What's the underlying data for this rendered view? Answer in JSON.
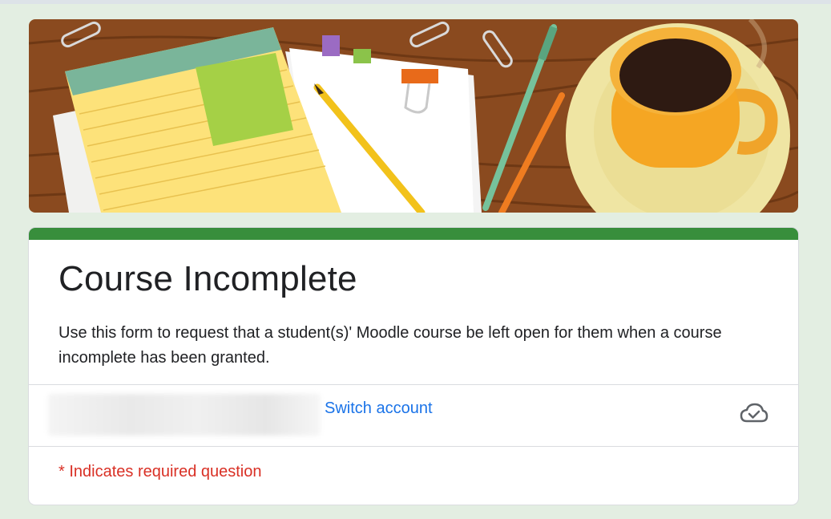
{
  "form": {
    "title": "Course Incomplete",
    "description": "Use this form to request that a student(s)' Moodle course be left open for them when a course incomplete has been granted.",
    "switch_account_label": "Switch account",
    "required_note": "* Indicates required question",
    "saved_status_icon": "cloud-check-icon"
  },
  "colors": {
    "accent": "#388e3c",
    "link": "#1a73e8",
    "required": "#d93025",
    "page_background": "#e3eee2"
  }
}
